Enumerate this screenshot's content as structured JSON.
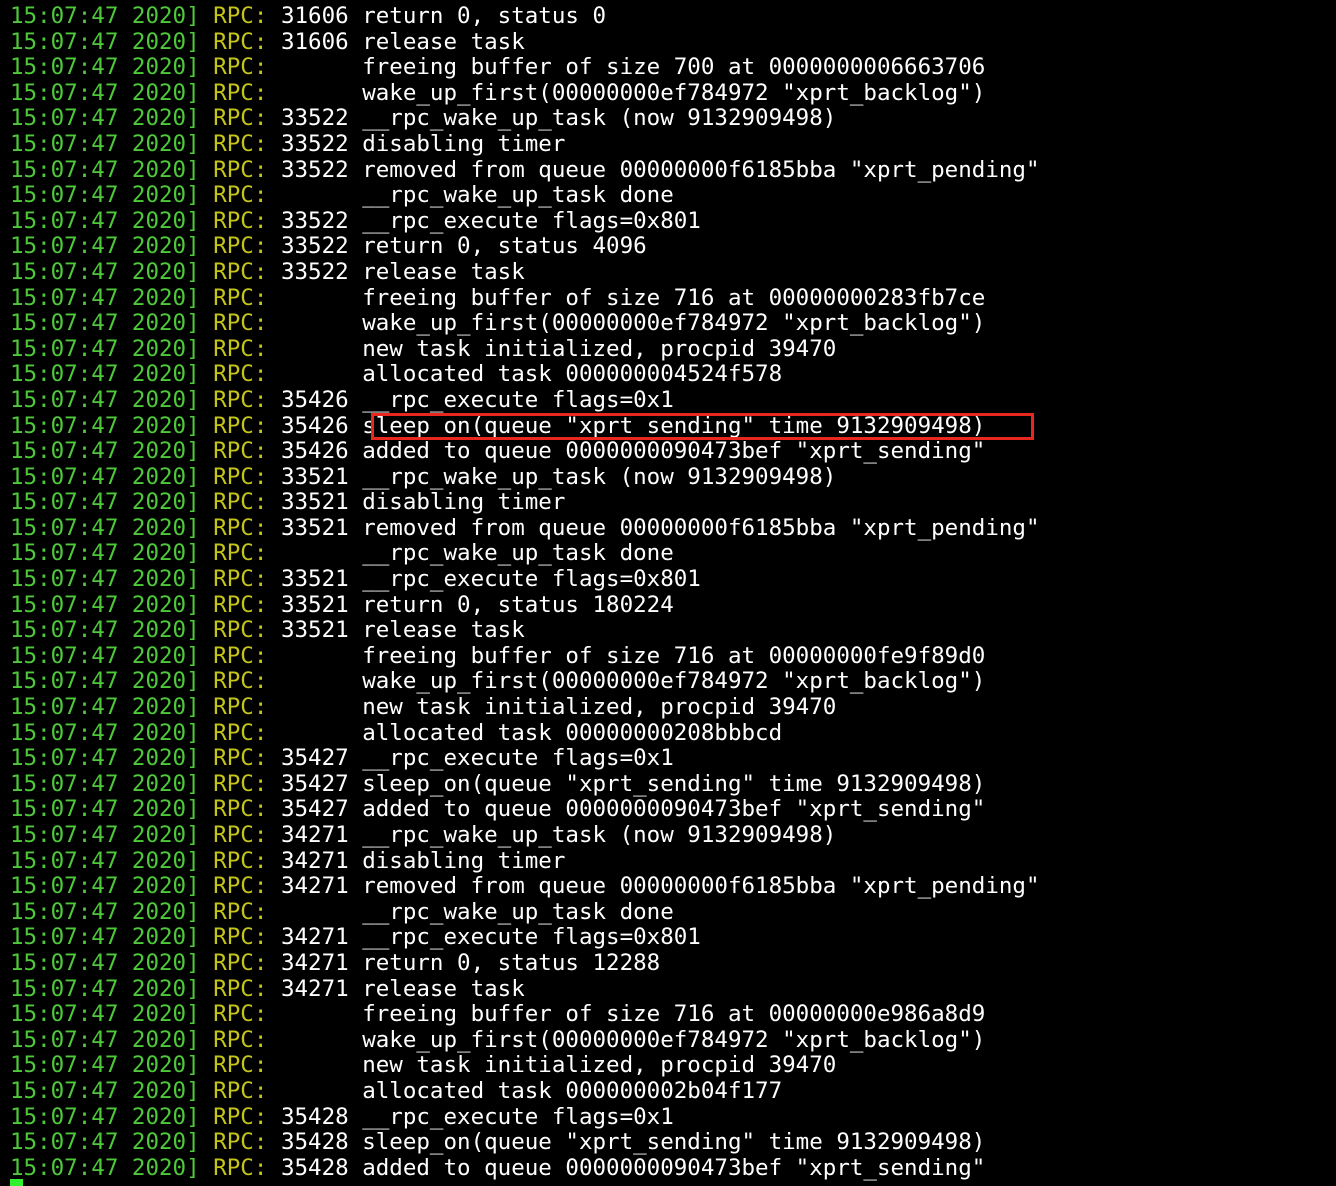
{
  "terminal": {
    "colors": {
      "background": "#000000",
      "timestamp": "#4ec93a",
      "tag": "#c4c41a",
      "text": "#ffffff",
      "highlight_border": "#e8271f",
      "cursor": "#2ff02f"
    },
    "highlighted_line_index": 16,
    "lines": [
      {
        "ts": "15:07:47 2020]",
        "tag": "RPC:",
        "pid": "31606",
        "msg": "return 0, status 0"
      },
      {
        "ts": "15:07:47 2020]",
        "tag": "RPC:",
        "pid": "31606",
        "msg": "release task"
      },
      {
        "ts": "15:07:47 2020]",
        "tag": "RPC:",
        "pid": "",
        "msg": "freeing buffer of size 700 at 0000000006663706"
      },
      {
        "ts": "15:07:47 2020]",
        "tag": "RPC:",
        "pid": "",
        "msg": "wake_up_first(00000000ef784972 \"xprt_backlog\")"
      },
      {
        "ts": "15:07:47 2020]",
        "tag": "RPC:",
        "pid": "33522",
        "msg": "__rpc_wake_up_task (now 9132909498)"
      },
      {
        "ts": "15:07:47 2020]",
        "tag": "RPC:",
        "pid": "33522",
        "msg": "disabling timer"
      },
      {
        "ts": "15:07:47 2020]",
        "tag": "RPC:",
        "pid": "33522",
        "msg": "removed from queue 00000000f6185bba \"xprt_pending\""
      },
      {
        "ts": "15:07:47 2020]",
        "tag": "RPC:",
        "pid": "",
        "msg": "__rpc_wake_up_task done"
      },
      {
        "ts": "15:07:47 2020]",
        "tag": "RPC:",
        "pid": "33522",
        "msg": "__rpc_execute flags=0x801"
      },
      {
        "ts": "15:07:47 2020]",
        "tag": "RPC:",
        "pid": "33522",
        "msg": "return 0, status 4096"
      },
      {
        "ts": "15:07:47 2020]",
        "tag": "RPC:",
        "pid": "33522",
        "msg": "release task"
      },
      {
        "ts": "15:07:47 2020]",
        "tag": "RPC:",
        "pid": "",
        "msg": "freeing buffer of size 716 at 00000000283fb7ce"
      },
      {
        "ts": "15:07:47 2020]",
        "tag": "RPC:",
        "pid": "",
        "msg": "wake_up_first(00000000ef784972 \"xprt_backlog\")"
      },
      {
        "ts": "15:07:47 2020]",
        "tag": "RPC:",
        "pid": "",
        "msg": "new task initialized, procpid 39470"
      },
      {
        "ts": "15:07:47 2020]",
        "tag": "RPC:",
        "pid": "",
        "msg": "allocated task 000000004524f578"
      },
      {
        "ts": "15:07:47 2020]",
        "tag": "RPC:",
        "pid": "35426",
        "msg": "__rpc_execute flags=0x1"
      },
      {
        "ts": "15:07:47 2020]",
        "tag": "RPC:",
        "pid": "35426",
        "msg": "sleep_on(queue \"xprt_sending\" time 9132909498)"
      },
      {
        "ts": "15:07:47 2020]",
        "tag": "RPC:",
        "pid": "35426",
        "msg": "added to queue 0000000090473bef \"xprt_sending\""
      },
      {
        "ts": "15:07:47 2020]",
        "tag": "RPC:",
        "pid": "33521",
        "msg": "__rpc_wake_up_task (now 9132909498)"
      },
      {
        "ts": "15:07:47 2020]",
        "tag": "RPC:",
        "pid": "33521",
        "msg": "disabling timer"
      },
      {
        "ts": "15:07:47 2020]",
        "tag": "RPC:",
        "pid": "33521",
        "msg": "removed from queue 00000000f6185bba \"xprt_pending\""
      },
      {
        "ts": "15:07:47 2020]",
        "tag": "RPC:",
        "pid": "",
        "msg": "__rpc_wake_up_task done"
      },
      {
        "ts": "15:07:47 2020]",
        "tag": "RPC:",
        "pid": "33521",
        "msg": "__rpc_execute flags=0x801"
      },
      {
        "ts": "15:07:47 2020]",
        "tag": "RPC:",
        "pid": "33521",
        "msg": "return 0, status 180224"
      },
      {
        "ts": "15:07:47 2020]",
        "tag": "RPC:",
        "pid": "33521",
        "msg": "release task"
      },
      {
        "ts": "15:07:47 2020]",
        "tag": "RPC:",
        "pid": "",
        "msg": "freeing buffer of size 716 at 00000000fe9f89d0"
      },
      {
        "ts": "15:07:47 2020]",
        "tag": "RPC:",
        "pid": "",
        "msg": "wake_up_first(00000000ef784972 \"xprt_backlog\")"
      },
      {
        "ts": "15:07:47 2020]",
        "tag": "RPC:",
        "pid": "",
        "msg": "new task initialized, procpid 39470"
      },
      {
        "ts": "15:07:47 2020]",
        "tag": "RPC:",
        "pid": "",
        "msg": "allocated task 00000000208bbbcd"
      },
      {
        "ts": "15:07:47 2020]",
        "tag": "RPC:",
        "pid": "35427",
        "msg": "__rpc_execute flags=0x1"
      },
      {
        "ts": "15:07:47 2020]",
        "tag": "RPC:",
        "pid": "35427",
        "msg": "sleep_on(queue \"xprt_sending\" time 9132909498)"
      },
      {
        "ts": "15:07:47 2020]",
        "tag": "RPC:",
        "pid": "35427",
        "msg": "added to queue 0000000090473bef \"xprt_sending\""
      },
      {
        "ts": "15:07:47 2020]",
        "tag": "RPC:",
        "pid": "34271",
        "msg": "__rpc_wake_up_task (now 9132909498)"
      },
      {
        "ts": "15:07:47 2020]",
        "tag": "RPC:",
        "pid": "34271",
        "msg": "disabling timer"
      },
      {
        "ts": "15:07:47 2020]",
        "tag": "RPC:",
        "pid": "34271",
        "msg": "removed from queue 00000000f6185bba \"xprt_pending\""
      },
      {
        "ts": "15:07:47 2020]",
        "tag": "RPC:",
        "pid": "",
        "msg": "__rpc_wake_up_task done"
      },
      {
        "ts": "15:07:47 2020]",
        "tag": "RPC:",
        "pid": "34271",
        "msg": "__rpc_execute flags=0x801"
      },
      {
        "ts": "15:07:47 2020]",
        "tag": "RPC:",
        "pid": "34271",
        "msg": "return 0, status 12288"
      },
      {
        "ts": "15:07:47 2020]",
        "tag": "RPC:",
        "pid": "34271",
        "msg": "release task"
      },
      {
        "ts": "15:07:47 2020]",
        "tag": "RPC:",
        "pid": "",
        "msg": "freeing buffer of size 716 at 00000000e986a8d9"
      },
      {
        "ts": "15:07:47 2020]",
        "tag": "RPC:",
        "pid": "",
        "msg": "wake_up_first(00000000ef784972 \"xprt_backlog\")"
      },
      {
        "ts": "15:07:47 2020]",
        "tag": "RPC:",
        "pid": "",
        "msg": "new task initialized, procpid 39470"
      },
      {
        "ts": "15:07:47 2020]",
        "tag": "RPC:",
        "pid": "",
        "msg": "allocated task 000000002b04f177"
      },
      {
        "ts": "15:07:47 2020]",
        "tag": "RPC:",
        "pid": "35428",
        "msg": "__rpc_execute flags=0x1"
      },
      {
        "ts": "15:07:47 2020]",
        "tag": "RPC:",
        "pid": "35428",
        "msg": "sleep_on(queue \"xprt_sending\" time 9132909498)"
      },
      {
        "ts": "15:07:47 2020]",
        "tag": "RPC:",
        "pid": "35428",
        "msg": "added to queue 0000000090473bef \"xprt_sending\""
      }
    ]
  }
}
